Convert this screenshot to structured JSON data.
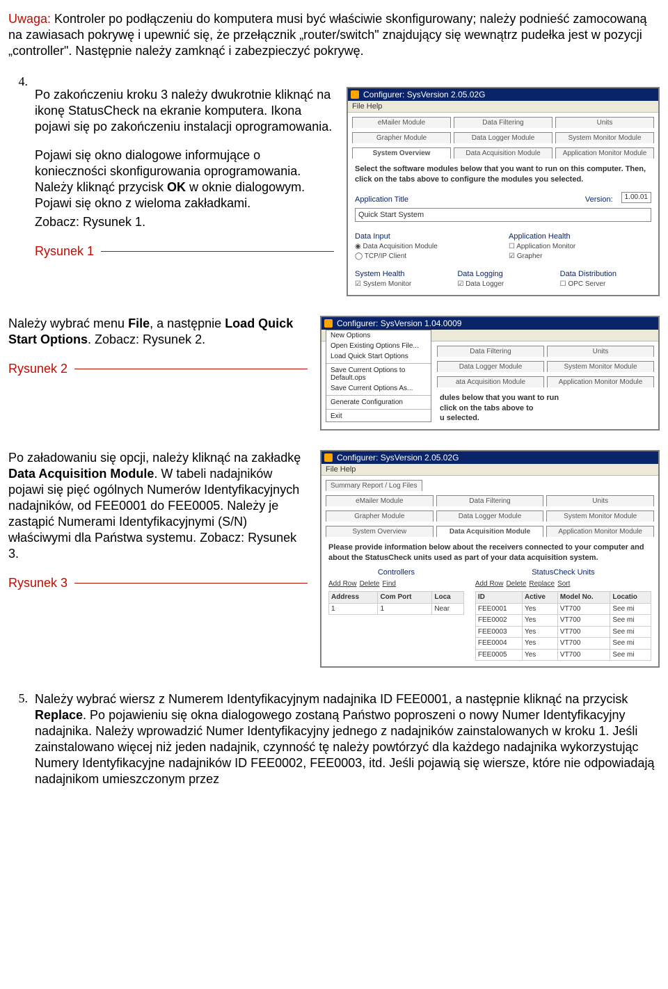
{
  "intro": {
    "warn_label": "Uwaga:",
    "warn_body": " Kontroler po podłączeniu do komputera musi być właściwie skonfigurowany; należy podnieść zamocowaną na zawiasach pokrywę i upewnić się, że przełącznik „router/switch\" znajdujący się wewnątrz pudełka jest w pozycji „controller\". Następnie należy zamknąć i zabezpieczyć pokrywę."
  },
  "step4": {
    "num": "4.",
    "body": "Po zakończeniu kroku 3 należy dwukrotnie kliknąć na ikonę StatusCheck na ekranie komputera. Ikona pojawi się po zakończeniu instalacji oprogramowania."
  },
  "midpara": {
    "a": "Pojawi się okno dialogowe informujące o konieczności skonfigurowania oprogramowania. Należy kliknąć przycisk ",
    "ok": "OK",
    "b": " w oknie dialogowym. Pojawi się okno z wieloma zakładkami.",
    "see": "Zobacz: Rysunek 1."
  },
  "fig1": "Rysunek 1",
  "para2": {
    "a": "Należy wybrać menu ",
    "file": "File",
    "b": ", a następnie ",
    "load": "Load Quick Start Options",
    "c": ". Zobacz: Rysunek 2."
  },
  "fig2": "Rysunek 2",
  "para3": {
    "a": "Po załadowaniu się opcji, należy kliknąć na zakładkę ",
    "tab": "Data Acquisition Module",
    "b": ". W tabeli nadajników pojawi się pięć ogólnych Numerów Identyfikacyjnych nadajników, od FEE0001 do FEE0005. Należy je zastąpić Numerami Identyfikacyjnymi (S/N) właściwymi dla Państwa systemu. Zobacz: Rysunek 3."
  },
  "fig3": "Rysunek 3",
  "step5": {
    "num": "5.",
    "a": "Należy wybrać wiersz z Numerem Identyfikacyjnym nadajnika ID FEE0001, a następnie kliknąć na przycisk ",
    "replace": "Replace",
    "b": ". Po pojawieniu się okna dialogowego zostaną Państwo poproszeni o nowy Numer Identyfikacyjny nadajnika. Należy wprowadzić Numer Identyfikacyjny jednego z nadajników zainstalowanych w kroku 1. Jeśli zainstalowano więcej niż jeden nadajnik, czynność tę należy powtórzyć dla każdego nadajnika wykorzystując Numery Identyfikacyjne nadajników ID FEE0002, FEE0003, itd. Jeśli pojawią się wiersze, które nie odpowiadają nadajnikom umieszczonym przez"
  },
  "win1": {
    "title": "Configurer:  SysVersion 2.05.02G",
    "menu": "File   Help",
    "tabs_top": [
      "eMailer Module",
      "Data Filtering",
      "Units"
    ],
    "tabs_mid": [
      "Grapher Module",
      "Data Logger Module",
      "System Monitor Module"
    ],
    "tabs_bot": [
      "System Overview",
      "Data Acquisition Module",
      "Application Monitor Module"
    ],
    "body_line": "Select the software modules below that you want to run on this computer.  Then, click on the tabs above to configure the modules you selected.",
    "apptitle_lbl": "Application Title",
    "ver_lbl": "Version:",
    "ver_val": "1.00.01",
    "apptitle_val": "Quick Start System",
    "g1": "Data Input",
    "g1a": "Data Acquisition Module",
    "g1b": "TCP/IP Client",
    "g2": "Application Health",
    "g2a": "Application Monitor",
    "g2b": "Grapher",
    "g3": "System Health",
    "g3a": "System Monitor",
    "g4": "Data Logging",
    "g4a": "Data Logger",
    "g5": "Data Distribution",
    "g5a": "OPC Server"
  },
  "win2": {
    "title": "Configurer: SysVersion 1.04.0009",
    "menu_items": [
      "New Options",
      "Open Existing Options File...",
      "Load Quick Start Options",
      "Save Current Options to Default.ops",
      "Save Current Options As...",
      "Generate Configuration",
      "Exit"
    ],
    "tabs_top": [
      "Data Filtering",
      "Units"
    ],
    "tabs_mid": [
      "Data Logger Module",
      "System Monitor Module"
    ],
    "tabs_bot": [
      "ata Acquisition Module",
      "Application Monitor Module"
    ],
    "frag1": "dules below that you want to run",
    "frag2": "click on the tabs above to",
    "frag3": "u selected."
  },
  "win3": {
    "title": "Configurer:  SysVersion 2.05.02G",
    "menu": "File   Help",
    "tabs_top": [
      "Summary Report / Log Files"
    ],
    "tabs_mid": [
      "eMailer Module",
      "Data Filtering",
      "Units"
    ],
    "tabs_mid2": [
      "Grapher Module",
      "Data Logger Module",
      "System Monitor Module"
    ],
    "tabs_bot": [
      "System Overview",
      "Data Acquisition Module",
      "Application Monitor Module"
    ],
    "body_line": "Please provide information below about the receivers connected to your computer and about the StatusCheck units used as part of your data acquisition system.",
    "left_title": "Controllers",
    "right_title": "StatusCheck Units",
    "left_btns": [
      "Add Row",
      "Delete",
      "Find"
    ],
    "right_btns": [
      "Add Row",
      "Delete",
      "Replace",
      "Sort"
    ],
    "left_cols": [
      "Address",
      "Com Port",
      "Loca"
    ],
    "left_row": [
      "1",
      "1",
      "Near"
    ],
    "right_cols": [
      "ID",
      "Active",
      "Model No.",
      "Locatio"
    ],
    "right_rows": [
      [
        "FEE0001",
        "Yes",
        "VT700",
        "See mi"
      ],
      [
        "FEE0002",
        "Yes",
        "VT700",
        "See mi"
      ],
      [
        "FEE0003",
        "Yes",
        "VT700",
        "See mi"
      ],
      [
        "FEE0004",
        "Yes",
        "VT700",
        "See mi"
      ],
      [
        "FEE0005",
        "Yes",
        "VT700",
        "See mi"
      ]
    ]
  }
}
